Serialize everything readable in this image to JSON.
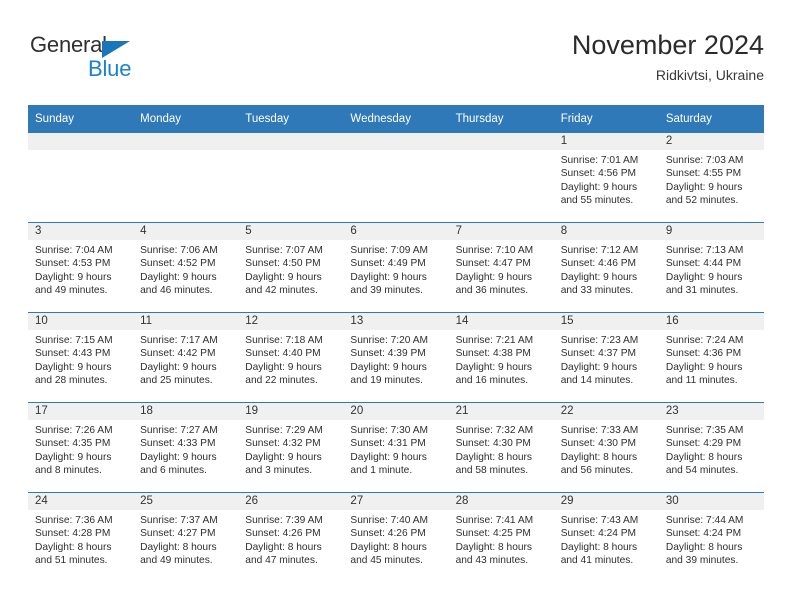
{
  "logo": {
    "word_general": "General",
    "word_blue": "Blue",
    "flag_icon": "blue-triangle-flag-icon",
    "brand_color": "#1b82d2"
  },
  "header": {
    "month_title": "November 2024",
    "location": "Ridkivtsi, Ukraine"
  },
  "theme": {
    "header_blue": "#3079b8",
    "date_band_gray": "#f0f0f0",
    "text": "#2f2f2f"
  },
  "weekday_headers": [
    "Sunday",
    "Monday",
    "Tuesday",
    "Wednesday",
    "Thursday",
    "Friday",
    "Saturday"
  ],
  "weeks": [
    [
      {
        "day": "",
        "empty": true
      },
      {
        "day": "",
        "empty": true
      },
      {
        "day": "",
        "empty": true
      },
      {
        "day": "",
        "empty": true
      },
      {
        "day": "",
        "empty": true
      },
      {
        "day": "1",
        "sunrise": "Sunrise: 7:01 AM",
        "sunset": "Sunset: 4:56 PM",
        "daylight_1": "Daylight: 9 hours",
        "daylight_2": "and 55 minutes."
      },
      {
        "day": "2",
        "sunrise": "Sunrise: 7:03 AM",
        "sunset": "Sunset: 4:55 PM",
        "daylight_1": "Daylight: 9 hours",
        "daylight_2": "and 52 minutes."
      }
    ],
    [
      {
        "day": "3",
        "sunrise": "Sunrise: 7:04 AM",
        "sunset": "Sunset: 4:53 PM",
        "daylight_1": "Daylight: 9 hours",
        "daylight_2": "and 49 minutes."
      },
      {
        "day": "4",
        "sunrise": "Sunrise: 7:06 AM",
        "sunset": "Sunset: 4:52 PM",
        "daylight_1": "Daylight: 9 hours",
        "daylight_2": "and 46 minutes."
      },
      {
        "day": "5",
        "sunrise": "Sunrise: 7:07 AM",
        "sunset": "Sunset: 4:50 PM",
        "daylight_1": "Daylight: 9 hours",
        "daylight_2": "and 42 minutes."
      },
      {
        "day": "6",
        "sunrise": "Sunrise: 7:09 AM",
        "sunset": "Sunset: 4:49 PM",
        "daylight_1": "Daylight: 9 hours",
        "daylight_2": "and 39 minutes."
      },
      {
        "day": "7",
        "sunrise": "Sunrise: 7:10 AM",
        "sunset": "Sunset: 4:47 PM",
        "daylight_1": "Daylight: 9 hours",
        "daylight_2": "and 36 minutes."
      },
      {
        "day": "8",
        "sunrise": "Sunrise: 7:12 AM",
        "sunset": "Sunset: 4:46 PM",
        "daylight_1": "Daylight: 9 hours",
        "daylight_2": "and 33 minutes."
      },
      {
        "day": "9",
        "sunrise": "Sunrise: 7:13 AM",
        "sunset": "Sunset: 4:44 PM",
        "daylight_1": "Daylight: 9 hours",
        "daylight_2": "and 31 minutes."
      }
    ],
    [
      {
        "day": "10",
        "sunrise": "Sunrise: 7:15 AM",
        "sunset": "Sunset: 4:43 PM",
        "daylight_1": "Daylight: 9 hours",
        "daylight_2": "and 28 minutes."
      },
      {
        "day": "11",
        "sunrise": "Sunrise: 7:17 AM",
        "sunset": "Sunset: 4:42 PM",
        "daylight_1": "Daylight: 9 hours",
        "daylight_2": "and 25 minutes."
      },
      {
        "day": "12",
        "sunrise": "Sunrise: 7:18 AM",
        "sunset": "Sunset: 4:40 PM",
        "daylight_1": "Daylight: 9 hours",
        "daylight_2": "and 22 minutes."
      },
      {
        "day": "13",
        "sunrise": "Sunrise: 7:20 AM",
        "sunset": "Sunset: 4:39 PM",
        "daylight_1": "Daylight: 9 hours",
        "daylight_2": "and 19 minutes."
      },
      {
        "day": "14",
        "sunrise": "Sunrise: 7:21 AM",
        "sunset": "Sunset: 4:38 PM",
        "daylight_1": "Daylight: 9 hours",
        "daylight_2": "and 16 minutes."
      },
      {
        "day": "15",
        "sunrise": "Sunrise: 7:23 AM",
        "sunset": "Sunset: 4:37 PM",
        "daylight_1": "Daylight: 9 hours",
        "daylight_2": "and 14 minutes."
      },
      {
        "day": "16",
        "sunrise": "Sunrise: 7:24 AM",
        "sunset": "Sunset: 4:36 PM",
        "daylight_1": "Daylight: 9 hours",
        "daylight_2": "and 11 minutes."
      }
    ],
    [
      {
        "day": "17",
        "sunrise": "Sunrise: 7:26 AM",
        "sunset": "Sunset: 4:35 PM",
        "daylight_1": "Daylight: 9 hours",
        "daylight_2": "and 8 minutes."
      },
      {
        "day": "18",
        "sunrise": "Sunrise: 7:27 AM",
        "sunset": "Sunset: 4:33 PM",
        "daylight_1": "Daylight: 9 hours",
        "daylight_2": "and 6 minutes."
      },
      {
        "day": "19",
        "sunrise": "Sunrise: 7:29 AM",
        "sunset": "Sunset: 4:32 PM",
        "daylight_1": "Daylight: 9 hours",
        "daylight_2": "and 3 minutes."
      },
      {
        "day": "20",
        "sunrise": "Sunrise: 7:30 AM",
        "sunset": "Sunset: 4:31 PM",
        "daylight_1": "Daylight: 9 hours",
        "daylight_2": "and 1 minute."
      },
      {
        "day": "21",
        "sunrise": "Sunrise: 7:32 AM",
        "sunset": "Sunset: 4:30 PM",
        "daylight_1": "Daylight: 8 hours",
        "daylight_2": "and 58 minutes."
      },
      {
        "day": "22",
        "sunrise": "Sunrise: 7:33 AM",
        "sunset": "Sunset: 4:30 PM",
        "daylight_1": "Daylight: 8 hours",
        "daylight_2": "and 56 minutes."
      },
      {
        "day": "23",
        "sunrise": "Sunrise: 7:35 AM",
        "sunset": "Sunset: 4:29 PM",
        "daylight_1": "Daylight: 8 hours",
        "daylight_2": "and 54 minutes."
      }
    ],
    [
      {
        "day": "24",
        "sunrise": "Sunrise: 7:36 AM",
        "sunset": "Sunset: 4:28 PM",
        "daylight_1": "Daylight: 8 hours",
        "daylight_2": "and 51 minutes."
      },
      {
        "day": "25",
        "sunrise": "Sunrise: 7:37 AM",
        "sunset": "Sunset: 4:27 PM",
        "daylight_1": "Daylight: 8 hours",
        "daylight_2": "and 49 minutes."
      },
      {
        "day": "26",
        "sunrise": "Sunrise: 7:39 AM",
        "sunset": "Sunset: 4:26 PM",
        "daylight_1": "Daylight: 8 hours",
        "daylight_2": "and 47 minutes."
      },
      {
        "day": "27",
        "sunrise": "Sunrise: 7:40 AM",
        "sunset": "Sunset: 4:26 PM",
        "daylight_1": "Daylight: 8 hours",
        "daylight_2": "and 45 minutes."
      },
      {
        "day": "28",
        "sunrise": "Sunrise: 7:41 AM",
        "sunset": "Sunset: 4:25 PM",
        "daylight_1": "Daylight: 8 hours",
        "daylight_2": "and 43 minutes."
      },
      {
        "day": "29",
        "sunrise": "Sunrise: 7:43 AM",
        "sunset": "Sunset: 4:24 PM",
        "daylight_1": "Daylight: 8 hours",
        "daylight_2": "and 41 minutes."
      },
      {
        "day": "30",
        "sunrise": "Sunrise: 7:44 AM",
        "sunset": "Sunset: 4:24 PM",
        "daylight_1": "Daylight: 8 hours",
        "daylight_2": "and 39 minutes."
      }
    ]
  ]
}
